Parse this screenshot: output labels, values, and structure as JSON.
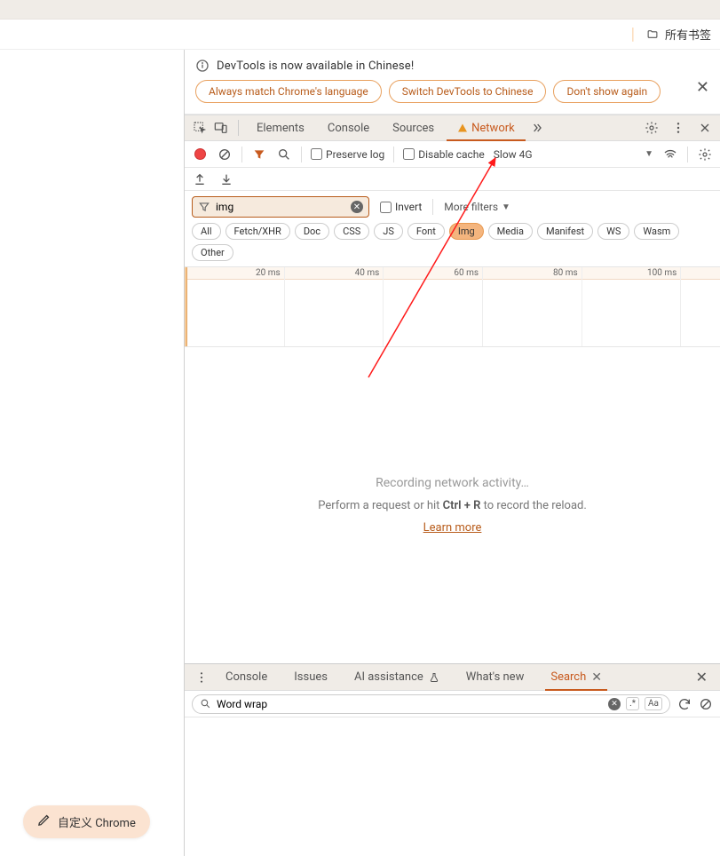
{
  "bookmarks": {
    "all_label": "所有书签"
  },
  "customize_label": "自定义 Chrome",
  "banner": {
    "text": "DevTools is now available in Chinese!",
    "chip_match": "Always match Chrome's language",
    "chip_switch": "Switch DevTools to Chinese",
    "chip_dont": "Don't show again"
  },
  "tabs": {
    "elements": "Elements",
    "console": "Console",
    "sources": "Sources",
    "network": "Network"
  },
  "toolbar": {
    "preserve_log": "Preserve log",
    "disable_cache": "Disable cache",
    "throttle": "Slow 4G"
  },
  "filter": {
    "value": "img",
    "invert": "Invert",
    "more": "More filters",
    "types": [
      "All",
      "Fetch/XHR",
      "Doc",
      "CSS",
      "JS",
      "Font",
      "Img",
      "Media",
      "Manifest",
      "WS",
      "Wasm",
      "Other"
    ],
    "active_type": "Img"
  },
  "timeline": {
    "ticks": [
      "20 ms",
      "40 ms",
      "60 ms",
      "80 ms",
      "100 ms"
    ]
  },
  "empty": {
    "line1": "Recording network activity…",
    "line2_a": "Perform a request or hit ",
    "line2_kbd": "Ctrl + R",
    "line2_b": " to record the reload.",
    "learn": "Learn more"
  },
  "drawer": {
    "console": "Console",
    "issues": "Issues",
    "ai": "AI assistance",
    "whatsnew": "What's new",
    "search": "Search"
  },
  "search": {
    "value": "Word wrap",
    "aa": "Aa",
    "regex": ".*"
  }
}
